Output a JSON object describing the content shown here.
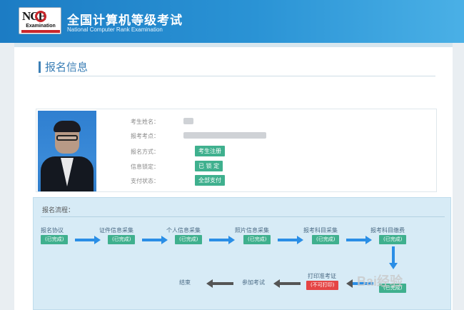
{
  "header": {
    "logo_text": "NCE",
    "logo_sub": "Examination",
    "title": "全国计算机等级考试",
    "subtitle": "National Computer Rank Examination"
  },
  "section_title": "报名信息",
  "info": {
    "fields": [
      {
        "label": "考生姓名：",
        "value_type": "blurred"
      },
      {
        "label": "报考考点：",
        "value_type": "blurred"
      },
      {
        "label": "报名方式：",
        "tag": "考生注册"
      },
      {
        "label": "信息锁定：",
        "tag": "已 锁 定"
      },
      {
        "label": "支付状态：",
        "tag": "全部支付"
      }
    ]
  },
  "process": {
    "title": "报名流程：",
    "steps": [
      {
        "label": "报名协议",
        "status": "(已完成)"
      },
      {
        "label": "证件信息采集",
        "status": "(已完成)"
      },
      {
        "label": "个人信息采集",
        "status": "(已完成)"
      },
      {
        "label": "照片信息采集",
        "status": "(已完成)"
      },
      {
        "label": "报考科目采集",
        "status": "(已完成)"
      },
      {
        "label": "报考科目缴费",
        "status": "(已完成)"
      },
      {
        "label": "打印准考证",
        "status": "(不可打印)"
      },
      {
        "label": "参加考试"
      },
      {
        "label": "结束"
      }
    ],
    "final_status": "(已完成)"
  },
  "watermark": "Bai经验"
}
